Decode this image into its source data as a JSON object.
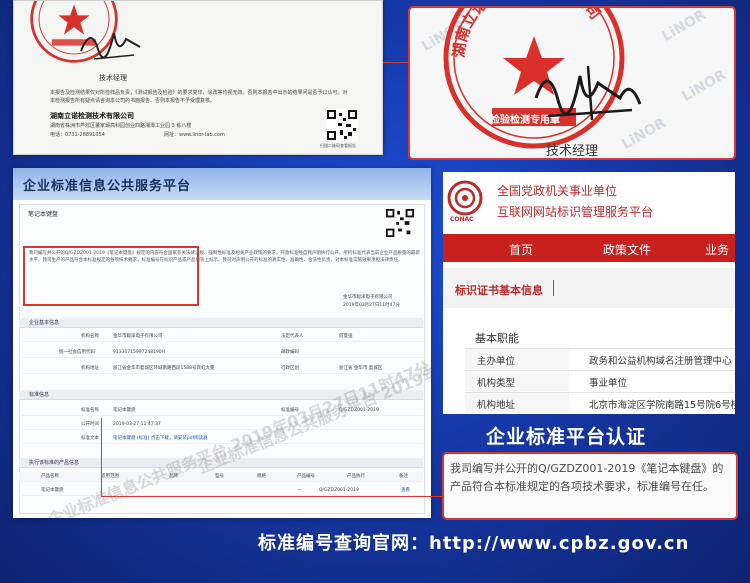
{
  "report": {
    "signature_title": "技术经理",
    "declaration": "本报告及检测结果仅对所检样品负责，《测试报告及检验》的要求复印、涂改等均视无效。否则本报告中出示的结果问是否予以认可。对本检测报告所有疑点请咨询本公司的书面报告、否则本报告不予受理复核。",
    "company": "湖南立诺检测技术有限公司",
    "address": "湖南省株洲市芦淞区董家塅高科园创业四路湘潭工业园 3 栋八楼",
    "phone": "电话：0731-28891054",
    "website": "网址：www.linor-lab.com",
    "qr_caption": "扫描二维码查看报告"
  },
  "zoom_seal": {
    "watermarks": [
      "LiNOR",
      "LiNOR",
      "LiNOR",
      "LiNOR"
    ],
    "seal_text": "湖南立诺检测技术有限公司",
    "seal_en": "HUNAN LINOR TESTING TECHNOLOGY",
    "seal_label": "检验检测专用章",
    "manager": "技术经理"
  },
  "std_site": {
    "site_title": "企业标准信息公共服务平台",
    "product_tab": "笔记本键盘",
    "declaration": "我司编写并公开的Q/GZDZ001-2019《笔记本键盘》规定的内容符合国家有关法律法规、强制性标准及相关产业政策的要求，开放标准经自我声明执行公开，所检标准代表当前企业产品质量的最新水平。我司生产的产品符合本标准规定的各项技术要求，标准编号在标识产品或产品包装上标示。我司对声明公开的标准的真实性、准确性、合法性负责，对本标准实施效果承担法律责任。",
    "issuer": "金华市聪泽电子有限公司",
    "issue_time": "2019年03月27日11时47分",
    "enterprise_section": "企业基本信息",
    "standard_section": "标准信息",
    "products_section": "执行该标准的产品信息",
    "rows": [
      {
        "k1": "机构名称",
        "v1": "金华市聪泽电子有限公司",
        "k2": "法定代表人",
        "v2": "何夏强"
      },
      {
        "k1": "统一社会信用代码",
        "v1": "91330715997248190H",
        "k2": "邮政编码",
        "v2": ""
      },
      {
        "k1": "机构地址",
        "v1": "浙江省金华市婺城区环城南路西段1588号宾虹大厦",
        "k2": "行政区划",
        "v2": "浙江省 金华市 婺城区"
      }
    ],
    "std_rows": [
      {
        "k1": "标准名称",
        "v1": "笔记本键盘",
        "k2": "标准编号",
        "v2": "Q/GZDZ001-2019"
      },
      {
        "k1": "公开时间",
        "v1": "2019-03-27 11:47:37",
        "k2": "",
        "v2": ""
      },
      {
        "k1": "标准文本",
        "v1": "笔记本键盘 (标准) 点击下载，请安装pdf阅读器",
        "k2": "",
        "v2": ""
      }
    ],
    "product_headers": [
      "产品名称",
      "适用范围",
      "品牌",
      "型号",
      "规格",
      "产品编号",
      "产品执行",
      "备注"
    ],
    "product_row": [
      "笔记本键盘",
      "",
      "",
      "",
      "",
      "—",
      "Q/GZDZ001-2019",
      "查看"
    ],
    "watermark": "企业标准信息公共服务平台 2019年03月27日11时47分"
  },
  "conac": {
    "logo_caption": "CONAC",
    "org_line1": "全国党政机关事业单位",
    "org_line2": "互联网网站标识管理服务平台",
    "nav": [
      "首页",
      "政策文件",
      "业务"
    ],
    "tab_label": "标识证书基本信息",
    "basic_title": "基本职能",
    "info_rows": [
      {
        "k": "主办单位",
        "v": "政务和公益机构域名注册管理中心"
      },
      {
        "k": "机构类型",
        "v": "事业单位"
      },
      {
        "k": "机构地址",
        "v": "北京市海淀区学院南路15号院6号楼"
      }
    ]
  },
  "caption_platform": "企业标准平台认证",
  "zoom_declaration": "我司编写并公开的Q/GZDZ001-2019《笔记本键盘》的产品符合本标准规定的各项技术要求，标准编号在任。",
  "caption_query": "标准编号查询官网：http://www.cpbz.gov.cn",
  "colors": {
    "background": "#1638a8",
    "accent_red": "#d43a30",
    "conac_red": "#c8211e"
  }
}
